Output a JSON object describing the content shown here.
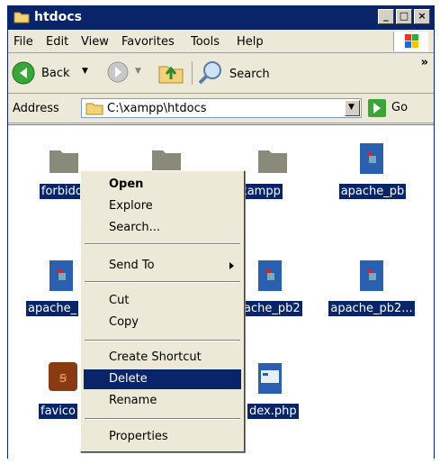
{
  "window": {
    "title": "htdocs"
  },
  "menu": {
    "file": "File",
    "edit": "Edit",
    "view": "View",
    "favorites": "Favorites",
    "tools": "Tools",
    "help": "Help"
  },
  "toolbar": {
    "back": "Back",
    "search": "Search",
    "more": "»"
  },
  "address": {
    "label": "Address",
    "path": "C:\\xampp\\htdocs",
    "go": "Go"
  },
  "files": [
    {
      "name": "forbidden",
      "icon": "folder-icon",
      "shown_label": "forbidd"
    },
    {
      "name": "xampp",
      "icon": "folder-icon",
      "shown_label": "xampp"
    },
    {
      "name": "apache_pb",
      "icon": "image-file-icon",
      "shown_label": "apache_pb"
    },
    {
      "name": "apache_pb",
      "icon": "image-file-icon",
      "shown_label": "apache_"
    },
    {
      "name": "apache_pb2",
      "icon": "image-file-icon",
      "shown_label": "ache_pb2"
    },
    {
      "name": "apache_pb2...",
      "icon": "image-file-icon",
      "shown_label": "apache_pb2..."
    },
    {
      "name": "favicon",
      "icon": "xampp-icon",
      "shown_label": "favico"
    },
    {
      "name": "index.php",
      "icon": "php-file-icon",
      "shown_label": "dex.php"
    }
  ],
  "context_menu": {
    "open": "Open",
    "explore": "Explore",
    "search": "Search...",
    "send_to": "Send To",
    "cut": "Cut",
    "copy": "Copy",
    "create_shortcut": "Create Shortcut",
    "delete": "Delete",
    "rename": "Rename",
    "properties": "Properties",
    "selected_item": "Delete"
  },
  "colors": {
    "selection": "#0a246a",
    "face": "#ece9d8"
  }
}
